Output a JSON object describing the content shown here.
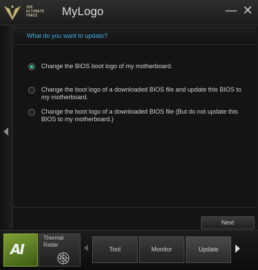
{
  "window": {
    "title": "MyLogo",
    "logo_text_1": "THE",
    "logo_text_2": "ULTIMATE",
    "logo_text_3": "FORCE",
    "minimize_symbol": "—",
    "close_symbol": "✕"
  },
  "main": {
    "question": "What do you want to update?",
    "options": [
      {
        "label": "Change the BIOS boot logo of my motherboard.",
        "selected": true
      },
      {
        "label": "Change the boot logo of a downloaded BIOS file and update this BIOS to my motherboard.",
        "selected": false
      },
      {
        "label": "Change the boot logo of a downloaded BIOS file (But do not update this BIOS to my motherboard.)",
        "selected": false
      }
    ],
    "next_label": "Next"
  },
  "dock": {
    "ai_label": "AI",
    "thermal_label": "Thermal Radar",
    "tabs": [
      "Tool",
      "Monitor",
      "Update"
    ]
  },
  "colors": {
    "accent_blue": "#42aee0",
    "radio_selected": "#3fd0a8",
    "ai_green": "#7fa035"
  },
  "icons": [
    "tuf-logo-icon",
    "minimize-icon",
    "close-icon",
    "left-arrow-icon",
    "radar-icon",
    "right-arrow-icon"
  ]
}
